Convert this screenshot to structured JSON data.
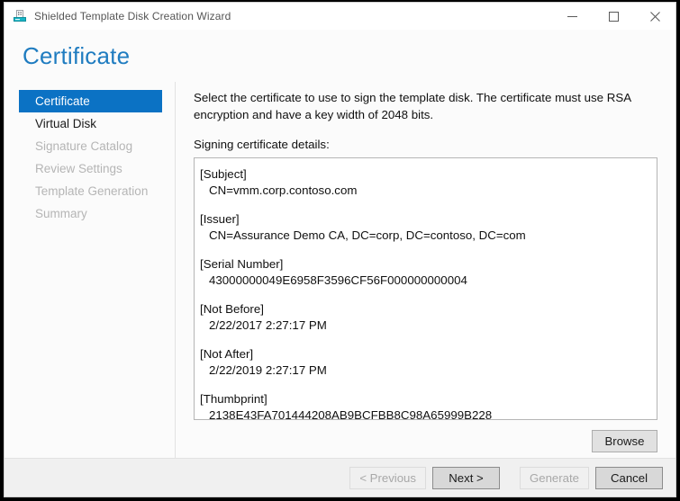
{
  "window": {
    "title": "Shielded Template Disk Creation Wizard",
    "icon": "disk-wizard-icon",
    "controls": {
      "minimize": "minimize-icon",
      "maximize": "maximize-icon",
      "close": "close-icon"
    }
  },
  "header": {
    "page_title": "Certificate",
    "accent_color": "#1f7cc0"
  },
  "sidebar": {
    "selected_color": "#0b72c4",
    "items": [
      {
        "label": "Certificate",
        "state": "selected"
      },
      {
        "label": "Virtual Disk",
        "state": "enabled"
      },
      {
        "label": "Signature Catalog",
        "state": "disabled"
      },
      {
        "label": "Review Settings",
        "state": "disabled"
      },
      {
        "label": "Template Generation",
        "state": "disabled"
      },
      {
        "label": "Summary",
        "state": "disabled"
      }
    ]
  },
  "main": {
    "instructions": "Select the certificate to use to sign the template disk. The certificate must use RSA encryption and have a key width of 2048 bits.",
    "details_label": "Signing certificate details:",
    "certificate": [
      {
        "key": "[Subject]",
        "value": "CN=vmm.corp.contoso.com"
      },
      {
        "key": "[Issuer]",
        "value": "CN=Assurance Demo CA, DC=corp, DC=contoso, DC=com"
      },
      {
        "key": "[Serial Number]",
        "value": "43000000049E6958F3596CF56F000000000004"
      },
      {
        "key": "[Not Before]",
        "value": "2/22/2017 2:27:17 PM"
      },
      {
        "key": "[Not After]",
        "value": "2/22/2019 2:27:17 PM"
      },
      {
        "key": "[Thumbprint]",
        "value": "2138E43FA701444208AB9BCFBB8C98A65999B228"
      }
    ],
    "browse_label": "Browse"
  },
  "footer": {
    "previous_label": "< Previous",
    "next_label": "Next >",
    "generate_label": "Generate",
    "cancel_label": "Cancel"
  }
}
